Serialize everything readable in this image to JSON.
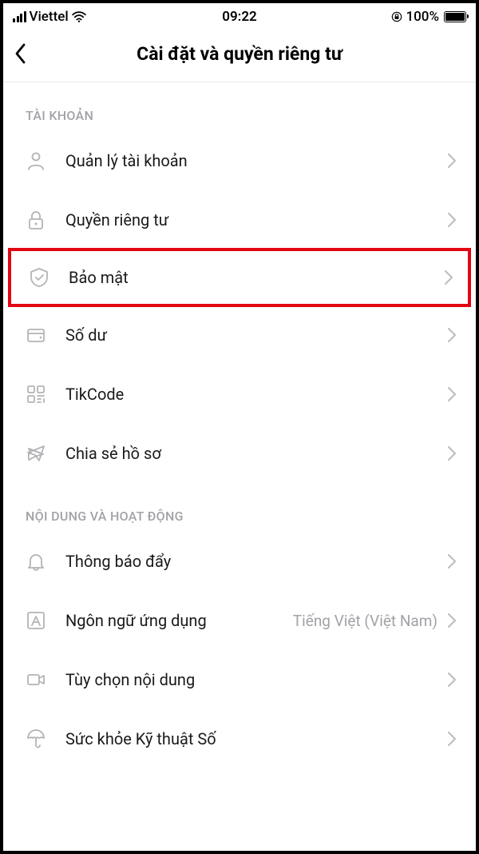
{
  "statusBar": {
    "carrier": "Viettel",
    "time": "09:22",
    "batteryPct": "100%"
  },
  "header": {
    "title": "Cài đặt và quyền riêng tư"
  },
  "sections": {
    "account": {
      "header": "TÀI KHOẢN",
      "items": {
        "manage": "Quản lý tài khoản",
        "privacy": "Quyền riêng tư",
        "security": "Bảo mật",
        "balance": "Số dư",
        "tikcode": "TikCode",
        "share": "Chia sẻ hồ sơ"
      }
    },
    "content": {
      "header": "NỘI DUNG VÀ HOẠT ĐỘNG",
      "items": {
        "push": "Thông báo đẩy",
        "language": {
          "label": "Ngôn ngữ ứng dụng",
          "value": "Tiếng Việt (Việt Nam)"
        },
        "contentPref": "Tùy chọn nội dung",
        "digital": "Sức khỏe Kỹ thuật Số"
      }
    }
  }
}
